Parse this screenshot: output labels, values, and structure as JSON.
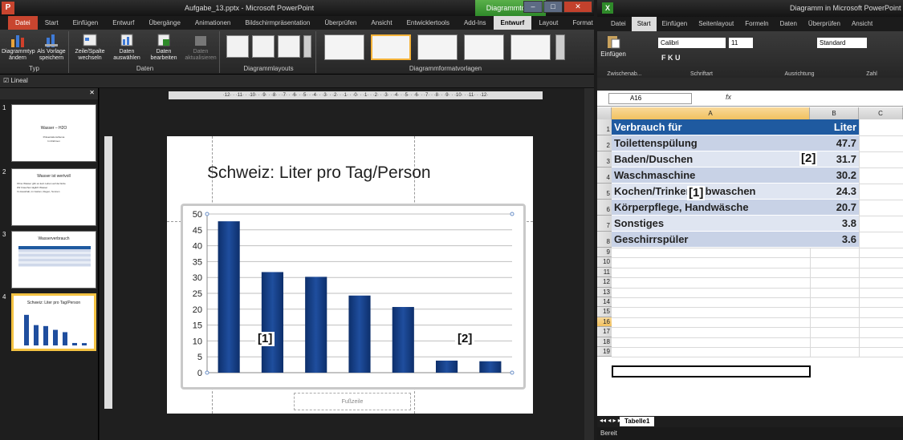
{
  "ppt": {
    "app_icon": "P",
    "title": "Aufgabe_13.pptx - Microsoft PowerPoint",
    "context_group": "Diagrammtools",
    "tabs": [
      "Datei",
      "Start",
      "Einfügen",
      "Entwurf",
      "Übergänge",
      "Animationen",
      "Bildschirmpräsentation",
      "Überprüfen",
      "Ansicht",
      "Entwicklertools",
      "Add-Ins",
      "Entwurf",
      "Layout",
      "Format"
    ],
    "ribbon": {
      "btn_change_type": "Diagrammtyp ändern",
      "btn_save_template": "Als Vorlage speichern",
      "group_type": "Typ",
      "btn_switch_row_col": "Zeile/Spalte wechseln",
      "btn_select_data": "Daten auswählen",
      "btn_edit_data": "Daten bearbeiten",
      "btn_refresh_data": "Daten aktualisieren",
      "group_data": "Daten",
      "group_layouts": "Diagrammlayouts",
      "group_styles": "Diagrammformatvorlagen"
    },
    "qat_label": "Lineal",
    "ruler_text": "·12· · ·11· · ·10· · ·9· · ·8· · ·7· · ·6· · ·5· · ·4· · ·3· · ·2· · ·1· · ·0· · ·1· · ·2· · ·3· · ·4· · ·5· · ·6· · ·7· · ·8· · ·9· · ·10· · ·11· · ·12·",
    "thumbnails": [
      {
        "num": "1",
        "title": "Wasser – H2O",
        "lines": [
          "Präsentationsthema",
          "Im Rahmen"
        ]
      },
      {
        "num": "2",
        "title": "Wasser ist wertvoll",
        "lines": [
          "Ohne Wasser gibt es kein Leben auf der Erde",
          "Wir brauchen täglich Wasser",
          "Im Haushalt, im Garten, Regen, Sonnen"
        ]
      },
      {
        "num": "3",
        "title": "Wasserverbrauch",
        "lines": []
      },
      {
        "num": "4",
        "title": "Schweiz: Liter pro Tag/Person",
        "lines": []
      }
    ],
    "slide_title": "Schweiz: Liter pro Tag/Person",
    "footer_placeholder": "Fußzeile",
    "callout_1": "[1]",
    "callout_2": "[2]"
  },
  "chart_data": {
    "type": "bar",
    "categories": [
      "Toilettenspülung",
      "Baden/Duschen",
      "Waschmaschine",
      "Kochen/Trinken, Abwaschen",
      "Körperpflege, Handwäsche",
      "Sonstiges",
      "Geschirrspüler"
    ],
    "values": [
      47.7,
      31.7,
      30.2,
      24.3,
      20.7,
      3.8,
      3.6
    ],
    "ylim": [
      0,
      50
    ],
    "yticks": [
      "0",
      "5",
      "10",
      "15",
      "20",
      "25",
      "30",
      "35",
      "40",
      "45",
      "50"
    ],
    "grid": true,
    "legend": "none",
    "bar_color": "#1f4e9e"
  },
  "excel": {
    "app_icon": "X",
    "title": "Diagramm in Microsoft PowerPoint",
    "tabs": [
      "Datei",
      "Start",
      "Einfügen",
      "Seitenlayout",
      "Formeln",
      "Daten",
      "Überprüfen",
      "Ansicht"
    ],
    "ribbon": {
      "paste": "Einfügen",
      "font_name": "Calibri",
      "font_size": "11",
      "number_format": "Standard",
      "group_clipboard": "Zwischenab...",
      "group_font": "Schriftart",
      "group_alignment": "Ausrichtung",
      "group_number": "Zahl"
    },
    "name_box": "A16",
    "fx": "fx",
    "columns": [
      "A",
      "B",
      "C"
    ],
    "header": {
      "a": "Verbrauch für",
      "b": "Liter"
    },
    "rows": [
      {
        "a": "Toilettenspülung",
        "b": "47.7"
      },
      {
        "a": "Baden/Duschen",
        "b": "31.7"
      },
      {
        "a": "Waschmaschine",
        "b": "30.2"
      },
      {
        "a": "Kochen/Trinken, Abwaschen",
        "b": "24.3"
      },
      {
        "a": "Körperpflege, Handwäsche",
        "b": "20.7"
      },
      {
        "a": "Sonstiges",
        "b": "3.8"
      },
      {
        "a": "Geschirrspüler",
        "b": "3.6"
      }
    ],
    "row_numbers": [
      "1",
      "2",
      "3",
      "4",
      "5",
      "6",
      "7",
      "8",
      "9",
      "10",
      "11",
      "12",
      "13",
      "14",
      "15",
      "16",
      "17",
      "18",
      "19"
    ],
    "sheet_tab": "Tabelle1",
    "status": "Bereit",
    "callout_1": "[1]",
    "callout_2": "[2]"
  }
}
